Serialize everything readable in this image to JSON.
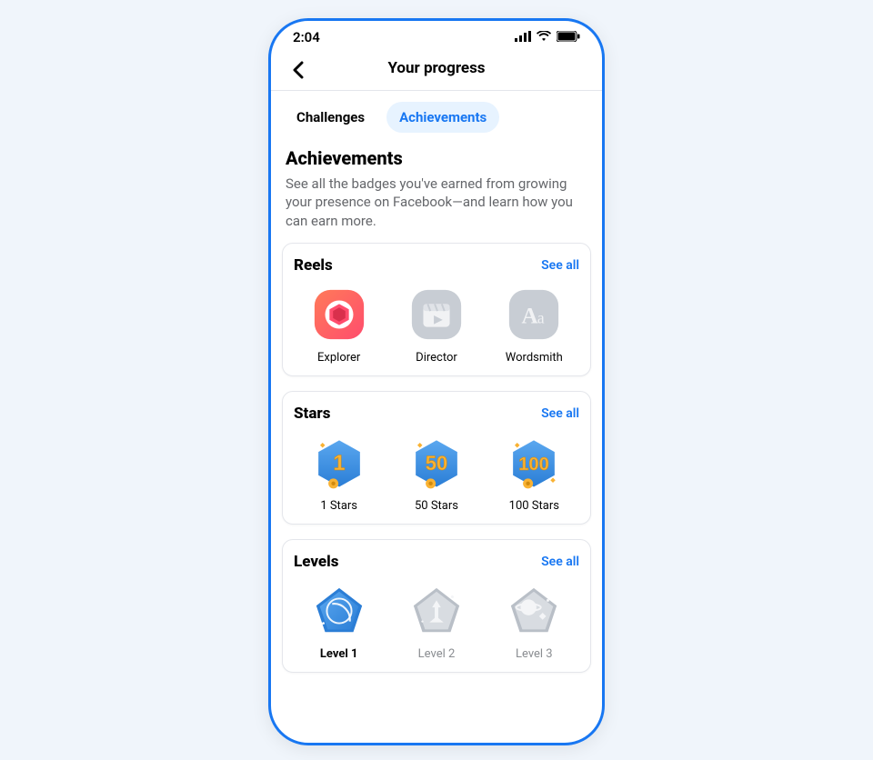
{
  "status_bar": {
    "time": "2:04"
  },
  "header": {
    "title": "Your progress"
  },
  "tabs": {
    "items": [
      {
        "label": "Challenges",
        "active": false
      },
      {
        "label": "Achievements",
        "active": true
      }
    ]
  },
  "intro": {
    "title": "Achievements",
    "subtitle": "See all the badges you've earned from growing your presence on Facebook—and learn how you can earn more."
  },
  "cards": {
    "reels": {
      "title": "Reels",
      "see_all": "See all",
      "badges": [
        {
          "label": "Explorer"
        },
        {
          "label": "Director"
        },
        {
          "label": "Wordsmith"
        }
      ]
    },
    "stars": {
      "title": "Stars",
      "see_all": "See all",
      "badges": [
        {
          "label": "1 Stars",
          "value": "1"
        },
        {
          "label": "50 Stars",
          "value": "50"
        },
        {
          "label": "100 Stars",
          "value": "100"
        }
      ]
    },
    "levels": {
      "title": "Levels",
      "see_all": "See all",
      "badges": [
        {
          "label": "Level 1"
        },
        {
          "label": "Level 2"
        },
        {
          "label": "Level 3"
        }
      ]
    }
  }
}
